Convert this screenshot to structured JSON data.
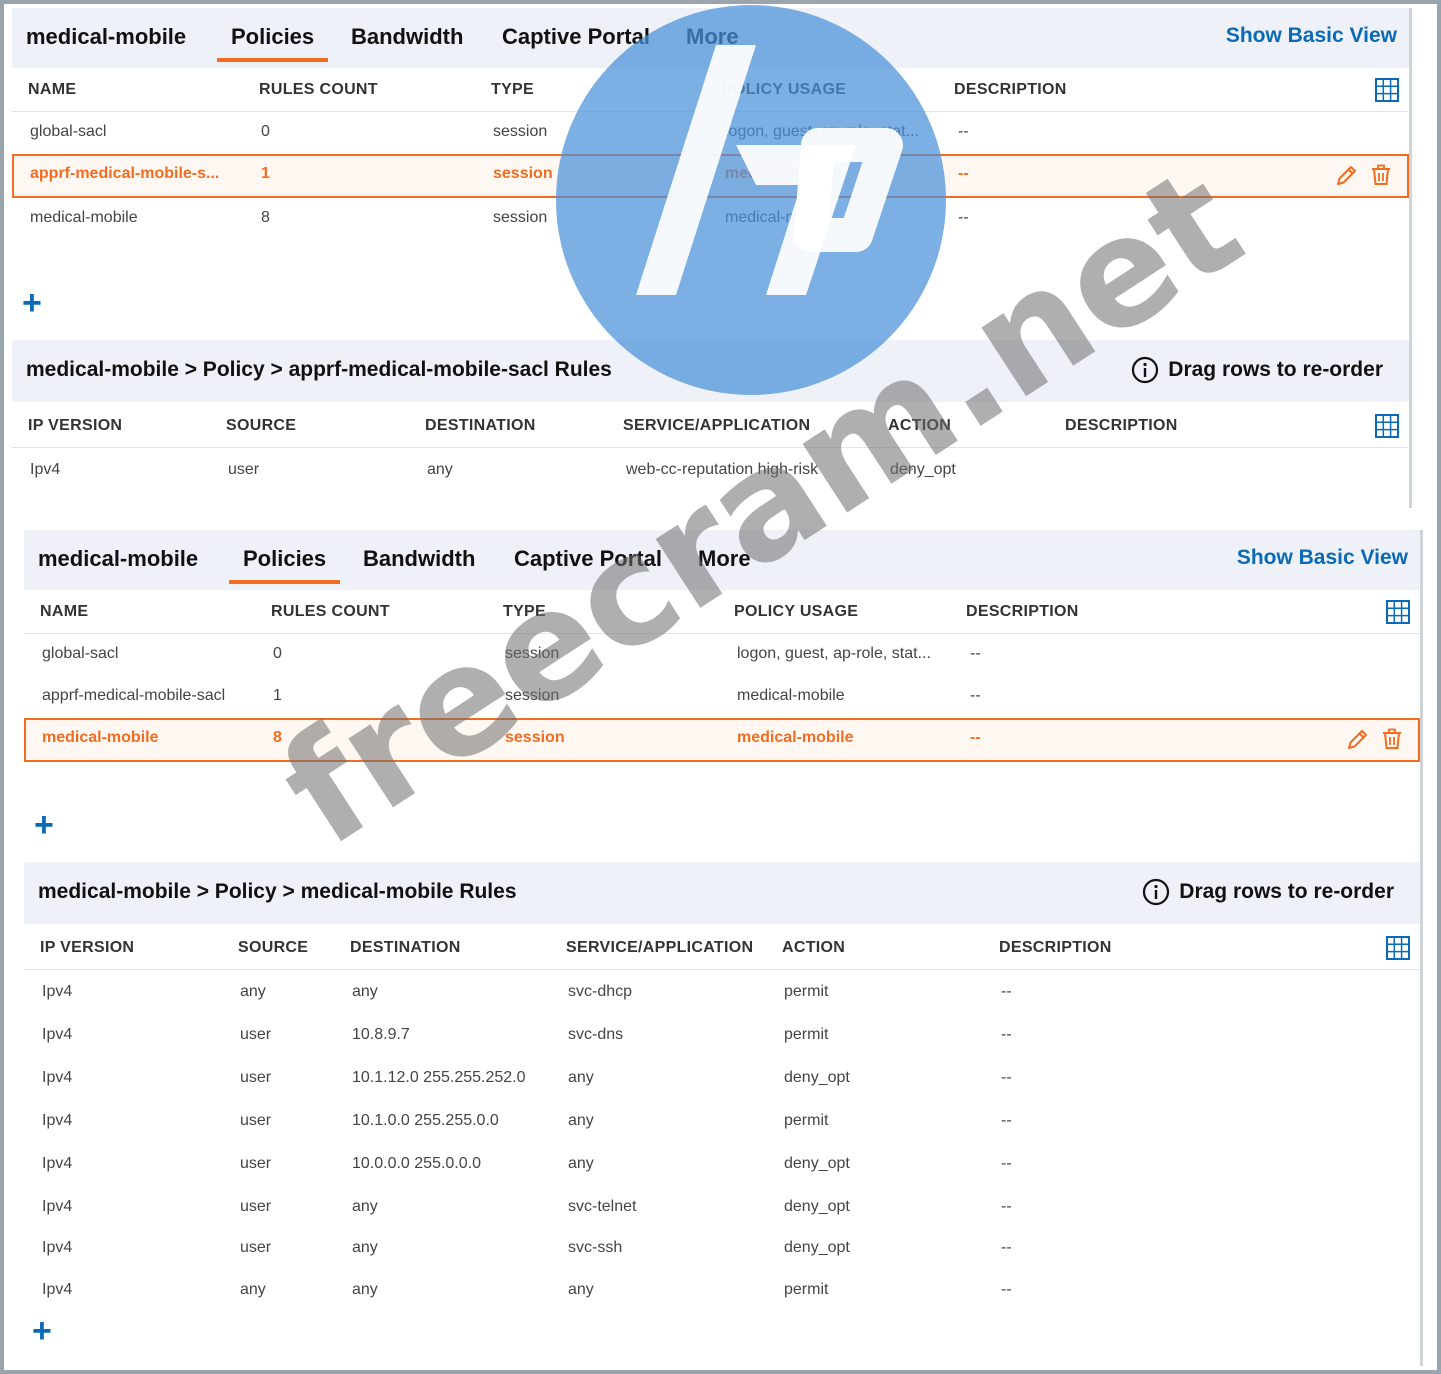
{
  "top_screen": {
    "header": {
      "app_name": "medical-mobile",
      "tabs": [
        "Policies",
        "Bandwidth",
        "Captive Portal",
        "More"
      ],
      "active_tab": "Policies",
      "basic_view_link": "Show Basic View"
    },
    "policies_table": {
      "columns": [
        "NAME",
        "RULES COUNT",
        "TYPE",
        "POLICY USAGE",
        "DESCRIPTION"
      ],
      "rows": [
        {
          "name": "global-sacl",
          "rules_count": "0",
          "type": "session",
          "usage": "logon, guest, ap-role, stat...",
          "description": "--"
        },
        {
          "name": "apprf-medical-mobile-s...",
          "rules_count": "1",
          "type": "session",
          "usage": "medical-mobile",
          "description": "--"
        },
        {
          "name": "medical-mobile",
          "rules_count": "8",
          "type": "session",
          "usage": "medical-mobile",
          "description": "--"
        }
      ],
      "selected_row": 1
    },
    "add_label": "+",
    "rules_section": {
      "breadcrumb": "medical-mobile > Policy > apprf-medical-mobile-sacl Rules",
      "hint": "Drag rows to re-order",
      "columns": [
        "IP VERSION",
        "SOURCE",
        "DESTINATION",
        "SERVICE/APPLICATION",
        "ACTION",
        "DESCRIPTION"
      ],
      "rows": [
        {
          "ip": "Ipv4",
          "source": "user",
          "destination": "any",
          "service": "web-cc-reputation high-risk",
          "action": "deny_opt",
          "description": ""
        }
      ]
    }
  },
  "bottom_screen": {
    "header": {
      "app_name": "medical-mobile",
      "tabs": [
        "Policies",
        "Bandwidth",
        "Captive Portal",
        "More"
      ],
      "active_tab": "Policies",
      "basic_view_link": "Show Basic View"
    },
    "policies_table": {
      "columns": [
        "NAME",
        "RULES COUNT",
        "TYPE",
        "POLICY USAGE",
        "DESCRIPTION"
      ],
      "rows": [
        {
          "name": "global-sacl",
          "rules_count": "0",
          "type": "session",
          "usage": "logon, guest, ap-role, stat...",
          "description": "--"
        },
        {
          "name": "apprf-medical-mobile-sacl",
          "rules_count": "1",
          "type": "session",
          "usage": "medical-mobile",
          "description": "--"
        },
        {
          "name": "medical-mobile",
          "rules_count": "8",
          "type": "session",
          "usage": "medical-mobile",
          "description": "--"
        }
      ],
      "selected_row": 2
    },
    "add_label": "+",
    "rules_section": {
      "breadcrumb": "medical-mobile > Policy > medical-mobile Rules",
      "hint": "Drag rows to re-order",
      "columns": [
        "IP VERSION",
        "SOURCE",
        "DESTINATION",
        "SERVICE/APPLICATION",
        "ACTION",
        "DESCRIPTION"
      ],
      "rows": [
        {
          "ip": "Ipv4",
          "source": "any",
          "destination": "any",
          "service": "svc-dhcp",
          "action": "permit",
          "description": "--"
        },
        {
          "ip": "Ipv4",
          "source": "user",
          "destination": "10.8.9.7",
          "service": "svc-dns",
          "action": "permit",
          "description": "--"
        },
        {
          "ip": "Ipv4",
          "source": "user",
          "destination": "10.1.12.0 255.255.252.0",
          "service": "any",
          "action": "deny_opt",
          "description": "--"
        },
        {
          "ip": "Ipv4",
          "source": "user",
          "destination": "10.1.0.0 255.255.0.0",
          "service": "any",
          "action": "permit",
          "description": "--"
        },
        {
          "ip": "Ipv4",
          "source": "user",
          "destination": "10.0.0.0 255.0.0.0",
          "service": "any",
          "action": "deny_opt",
          "description": "--"
        },
        {
          "ip": "Ipv4",
          "source": "user",
          "destination": "any",
          "service": "svc-telnet",
          "action": "deny_opt",
          "description": "--"
        },
        {
          "ip": "Ipv4",
          "source": "user",
          "destination": "any",
          "service": "svc-ssh",
          "action": "deny_opt",
          "description": "--"
        },
        {
          "ip": "Ipv4",
          "source": "any",
          "destination": "any",
          "service": "any",
          "action": "permit",
          "description": "--"
        }
      ]
    }
  },
  "watermark": {
    "logo": "hp",
    "text": "freecram.net"
  },
  "colors": {
    "accent_orange": "#f26c21",
    "link_blue": "#0a6ab5",
    "header_bg": "#eef2f8",
    "hp_logo_blue": "#4a90d9"
  },
  "icons": [
    "grid-view-icon",
    "edit-pencil-icon",
    "trash-icon",
    "info-icon",
    "plus-icon"
  ]
}
